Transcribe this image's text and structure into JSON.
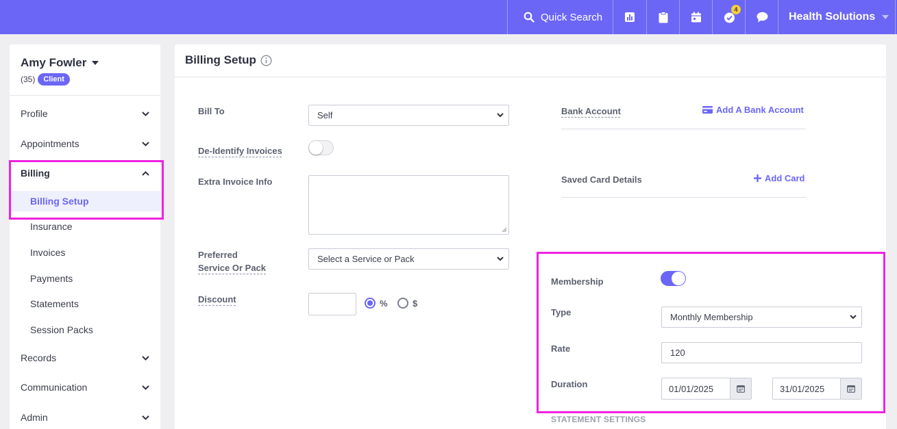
{
  "colors": {
    "brand": "#6b66f5",
    "highlight": "#ee22e0",
    "badge": "#f6cd3a"
  },
  "topbar": {
    "search_label": "Quick Search",
    "notification_count": "4",
    "org_name": "Health Solutions",
    "icons": [
      "bar-chart-icon",
      "clipboard-icon",
      "calendar-icon",
      "task-check-icon",
      "chat-icon"
    ]
  },
  "client": {
    "name": "Amy Fowler",
    "age": "(35)",
    "badge": "Client"
  },
  "sidebar": {
    "items": [
      {
        "label": "Profile"
      },
      {
        "label": "Appointments"
      },
      {
        "label": "Billing"
      },
      {
        "label": "Records"
      },
      {
        "label": "Communication"
      },
      {
        "label": "Admin"
      }
    ],
    "billing_subitems": [
      {
        "label": "Billing Setup"
      },
      {
        "label": "Insurance"
      },
      {
        "label": "Invoices"
      },
      {
        "label": "Payments"
      },
      {
        "label": "Statements"
      },
      {
        "label": "Session Packs"
      }
    ]
  },
  "page": {
    "title": "Billing Setup"
  },
  "form": {
    "bill_to_label": "Bill To",
    "bill_to_value": "Self",
    "deidentify_label": "De-Identify Invoices",
    "extra_info_label": "Extra Invoice Info",
    "preferred_label_1": "Preferred",
    "preferred_label_2": "Service Or Pack",
    "preferred_value": "Select a Service or Pack",
    "discount_label": "Discount",
    "discount_percent": "%",
    "discount_dollar": "$"
  },
  "right": {
    "bank_label": "Bank Account",
    "bank_action": "Add A Bank Account",
    "card_label": "Saved Card Details",
    "card_action": "Add Card"
  },
  "membership": {
    "label": "Membership",
    "type_label": "Type",
    "type_value": "Monthly Membership",
    "rate_label": "Rate",
    "rate_value": "120",
    "duration_label": "Duration",
    "start_date": "01/01/2025",
    "end_date": "31/01/2025"
  },
  "statement": {
    "heading": "STATEMENT SETTINGS"
  }
}
